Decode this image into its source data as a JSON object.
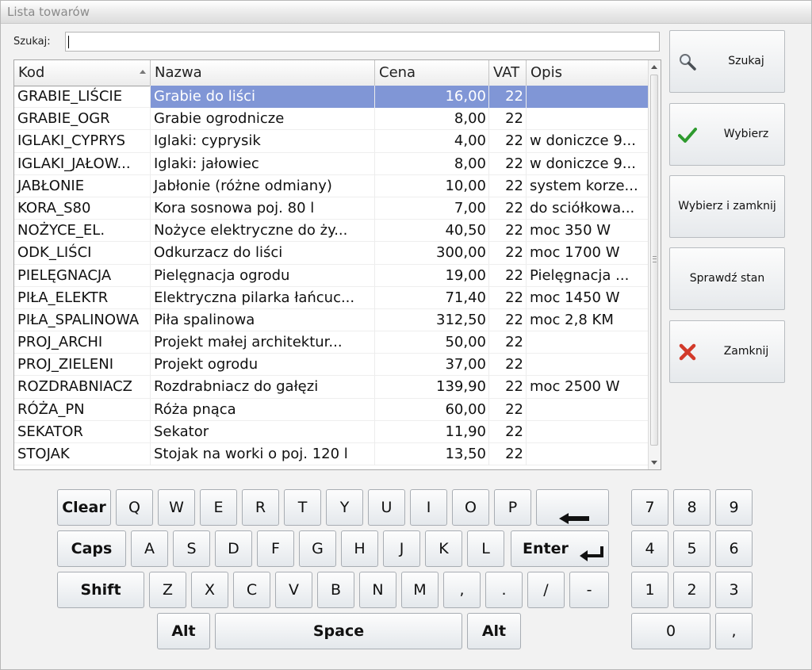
{
  "window": {
    "title": "Lista towarów"
  },
  "search": {
    "label": "Szukaj:",
    "value": ""
  },
  "table": {
    "columns": [
      "Kod",
      "Nazwa",
      "Cena",
      "VAT",
      "Opis"
    ],
    "sorted_column": "Kod",
    "sort_direction": "ascending",
    "rows": [
      {
        "kod": "GRABIE_LIŚCIE",
        "nazwa": "Grabie do liści",
        "cena": "16,00",
        "vat": "22",
        "opis": "",
        "selected": true
      },
      {
        "kod": "GRABIE_OGR",
        "nazwa": "Grabie ogrodnicze",
        "cena": "8,00",
        "vat": "22",
        "opis": ""
      },
      {
        "kod": "IGLAKI_CYPRYS",
        "nazwa": "Iglaki: cyprysik",
        "cena": "4,00",
        "vat": "22",
        "opis": "w doniczce 9..."
      },
      {
        "kod": "IGLAKI_JAŁOW...",
        "nazwa": "Iglaki: jałowiec",
        "cena": "8,00",
        "vat": "22",
        "opis": "w doniczce 9..."
      },
      {
        "kod": "JABŁONIE",
        "nazwa": "Jabłonie (różne odmiany)",
        "cena": "10,00",
        "vat": "22",
        "opis": "system korze..."
      },
      {
        "kod": "KORA_S80",
        "nazwa": "Kora sosnowa poj. 80 l",
        "cena": "7,00",
        "vat": "22",
        "opis": "do sciółkowa..."
      },
      {
        "kod": "NOŻYCE_EL.",
        "nazwa": "Nożyce elektryczne do ży...",
        "cena": "40,50",
        "vat": "22",
        "opis": "moc 350 W"
      },
      {
        "kod": "ODK_LIŚCI",
        "nazwa": "Odkurzacz do liści",
        "cena": "300,00",
        "vat": "22",
        "opis": "moc 1700 W"
      },
      {
        "kod": "PIELĘGNACJA",
        "nazwa": "Pielęgnacja ogrodu",
        "cena": "19,00",
        "vat": "22",
        "opis": "Pielęgnacja ..."
      },
      {
        "kod": "PIŁA_ELEKTR",
        "nazwa": "Elektryczna pilarka łańcuc...",
        "cena": "71,40",
        "vat": "22",
        "opis": "moc 1450 W"
      },
      {
        "kod": "PIŁA_SPALINOWA",
        "nazwa": "Piła spalinowa",
        "cena": "312,50",
        "vat": "22",
        "opis": "moc 2,8 KM"
      },
      {
        "kod": "PROJ_ARCHI",
        "nazwa": "Projekt małej architektur...",
        "cena": "50,00",
        "vat": "22",
        "opis": ""
      },
      {
        "kod": "PROJ_ZIELENI",
        "nazwa": "Projekt ogrodu",
        "cena": "37,00",
        "vat": "22",
        "opis": ""
      },
      {
        "kod": "ROZDRABNIACZ",
        "nazwa": "Rozdrabniacz do gałęzi",
        "cena": "139,90",
        "vat": "22",
        "opis": "moc 2500 W"
      },
      {
        "kod": "RÓŻA_PN",
        "nazwa": "Róża pnąca",
        "cena": "60,00",
        "vat": "22",
        "opis": ""
      },
      {
        "kod": "SEKATOR",
        "nazwa": "Sekator",
        "cena": "11,90",
        "vat": "22",
        "opis": ""
      },
      {
        "kod": "STOJAK",
        "nazwa": "Stojak na worki o poj. 120 l",
        "cena": "13,50",
        "vat": "22",
        "opis": ""
      }
    ]
  },
  "actions": {
    "search": {
      "label": "Szukaj",
      "icon": "magnifier-icon"
    },
    "select": {
      "label": "Wybierz",
      "icon": "checkmark-icon"
    },
    "select_close": {
      "label": "Wybierz i zamknij"
    },
    "check_stock": {
      "label": "Sprawdź stan"
    },
    "close": {
      "label": "Zamknij",
      "icon": "close-x-icon"
    }
  },
  "keyboard": {
    "row1": [
      "Clear",
      "Q",
      "W",
      "E",
      "R",
      "T",
      "Y",
      "U",
      "I",
      "O",
      "P"
    ],
    "backspace_icon": "left-arrow-icon",
    "row2": [
      "Caps",
      "A",
      "S",
      "D",
      "F",
      "G",
      "H",
      "J",
      "K",
      "L"
    ],
    "enter": "Enter",
    "enter_icon": "enter-return-icon",
    "row3": [
      "Shift",
      "Z",
      "X",
      "C",
      "V",
      "B",
      "N",
      "M",
      ",",
      ".",
      "/",
      "-"
    ],
    "row4": [
      "Alt",
      "Space",
      "Alt"
    ]
  },
  "numpad": {
    "keys": [
      "7",
      "8",
      "9",
      "4",
      "5",
      "6",
      "1",
      "2",
      "3",
      "0",
      ","
    ]
  },
  "colors": {
    "selection": "#8096d6",
    "check_green": "#2e9a2e",
    "close_red": "#d23a2a"
  }
}
